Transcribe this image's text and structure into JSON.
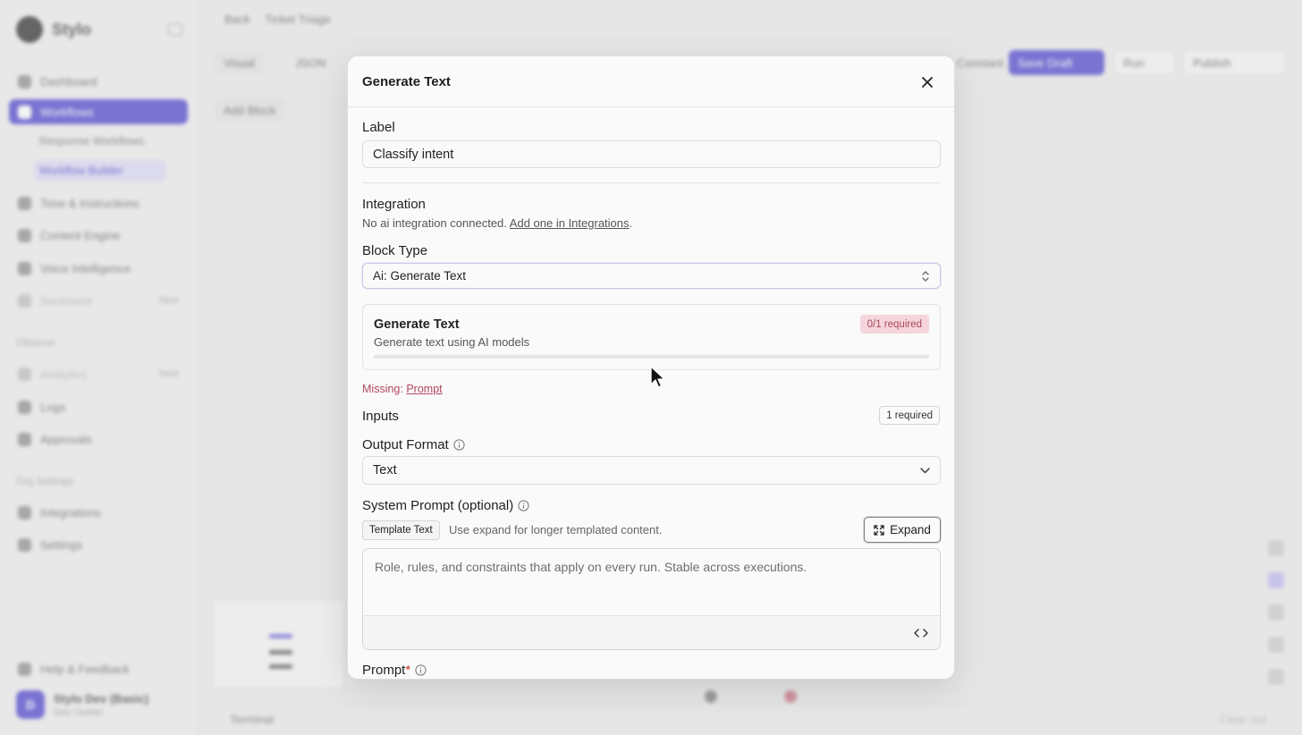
{
  "background": {
    "brand": "Stylo",
    "nav_top": [
      {
        "label": "Dashboard"
      },
      {
        "label": "Workflows"
      },
      {
        "label": "Tone & Instructions"
      },
      {
        "label": "Content Engine"
      },
      {
        "label": "Voice Intelligence"
      },
      {
        "label": "Sentiment",
        "tag": "New"
      }
    ],
    "sub_items": [
      "Response Workflows",
      "Workflow Builder"
    ],
    "group_observe": "Observe",
    "nav_observe": [
      {
        "label": "Analytics",
        "tag": "New"
      },
      {
        "label": "Logs"
      },
      {
        "label": "Approvals"
      }
    ],
    "group_org": "Org Settings",
    "nav_org": [
      {
        "label": "Integrations"
      },
      {
        "label": "Settings"
      }
    ],
    "help": "Help & Feedback",
    "user": {
      "initial": "D",
      "name": "Stylo Dev (Basic)",
      "role": "Dev Owner"
    },
    "topbar": {
      "back": "Back",
      "title": "Ticket Triage"
    },
    "toolbar": {
      "visual": "Visual",
      "json": "JSON",
      "constant": "Constant",
      "save": "Save Draft",
      "run": "Run",
      "publish": "Publish"
    },
    "add_block": "Add Block",
    "terminal": "Terminal",
    "clear": "Clear out"
  },
  "modal": {
    "title": "Generate Text",
    "label_field": {
      "label": "Label",
      "value": "Classify intent"
    },
    "integration": {
      "heading": "Integration",
      "text": "No ai integration connected.",
      "link": "Add one in Integrations",
      "suffix": "."
    },
    "block_type": {
      "label": "Block Type",
      "value": "Ai: Generate Text"
    },
    "card": {
      "title": "Generate Text",
      "description": "Generate text using AI models",
      "badge": "0/1 required",
      "progress": 0
    },
    "missing": {
      "prefix": "Missing:",
      "item": "Prompt"
    },
    "inputs": {
      "heading": "Inputs",
      "badge": "1 required"
    },
    "output_format": {
      "label": "Output Format",
      "value": "Text"
    },
    "system_prompt": {
      "label": "System Prompt (optional)",
      "chip": "Template Text",
      "hint": "Use expand for longer templated content.",
      "expand": "Expand",
      "placeholder": "Role, rules, and constraints that apply on every run. Stable across executions."
    },
    "prompt": {
      "label": "Prompt",
      "required_mark": "*"
    }
  },
  "colors": {
    "accent": "#4338ca",
    "required_badge_bg": "#f6d5dc",
    "required_badge_text": "#a8475a",
    "missing_text": "#b0475d"
  },
  "icons": {
    "close": "close-icon",
    "chevron": "chevron-updown-icon",
    "info": "info-icon",
    "expand": "expand-icon",
    "code": "code-icon"
  }
}
